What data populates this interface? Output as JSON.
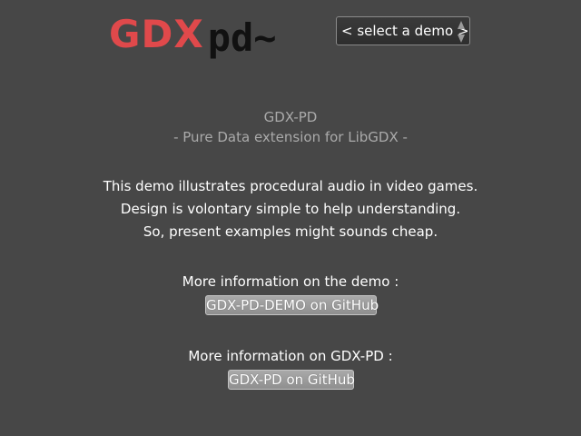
{
  "header": {
    "logo_gdx": "GDX",
    "logo_pd": "pd~",
    "demo_select": {
      "selected": "< select a demo >"
    }
  },
  "intro": {
    "title": "GDX-PD",
    "subtitle": "- Pure Data extension for LibGDX -"
  },
  "description": {
    "line1": "This demo illustrates procedural audio in video games.",
    "line2": "Design is volontary simple to help understanding.",
    "line3": "So, present examples might sounds cheap."
  },
  "demo_info": {
    "label": "More information on the demo :",
    "link_label": "GDX-PD-DEMO on GitHub"
  },
  "gdxpd_info": {
    "label": "More information on GDX-PD :",
    "link_label": "GDX-PD on GitHub"
  },
  "colors": {
    "background": "#474747",
    "logo_red": "#e0494b",
    "logo_black": "#111111",
    "muted_text": "#aaaaaa",
    "button_gray": "#9a9a9a"
  }
}
